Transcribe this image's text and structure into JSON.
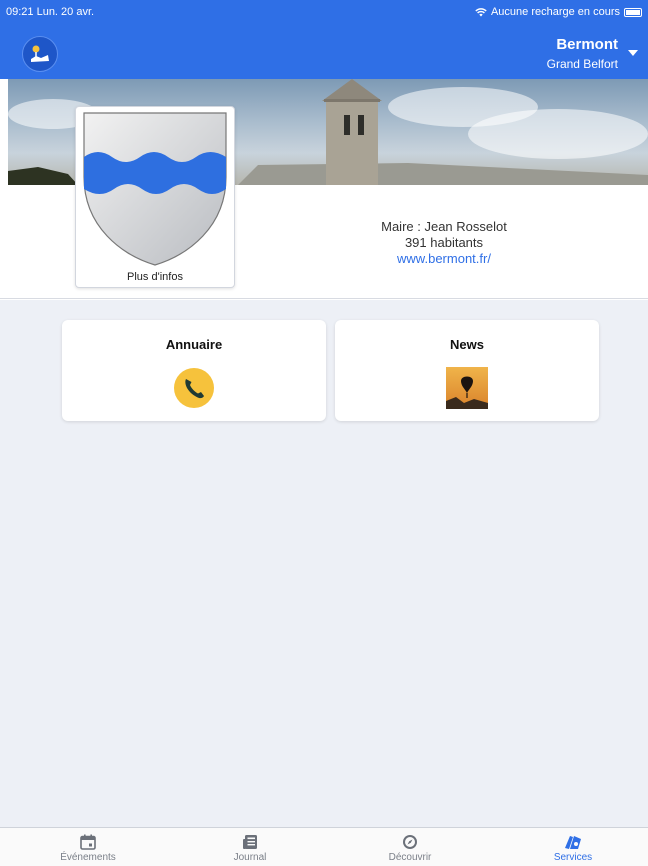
{
  "status_bar": {
    "time_date": "09:21  Lun. 20 avr.",
    "charging": "Aucune recharge en cours"
  },
  "header": {
    "town": "Bermont",
    "region": "Grand Belfort"
  },
  "crest": {
    "label": "Plus d'infos"
  },
  "info": {
    "mayor": "Maire : Jean Rosselot",
    "population": "391 habitants",
    "website": "www.bermont.fr/"
  },
  "services": [
    {
      "label": "Annuaire",
      "icon": "phone-icon"
    },
    {
      "label": "News",
      "icon": "balloon-icon"
    }
  ],
  "tabs": [
    {
      "label": "Événements",
      "icon": "calendar-icon",
      "active": false
    },
    {
      "label": "Journal",
      "icon": "newspaper-icon",
      "active": false
    },
    {
      "label": "Découvrir",
      "icon": "compass-icon",
      "active": false
    },
    {
      "label": "Services",
      "icon": "services-icon",
      "active": true
    }
  ],
  "colors": {
    "primary": "#2f6fe6",
    "background": "#edf0f6",
    "crest_blue": "#2e6fe0",
    "phone_yellow": "#f6c23c"
  }
}
